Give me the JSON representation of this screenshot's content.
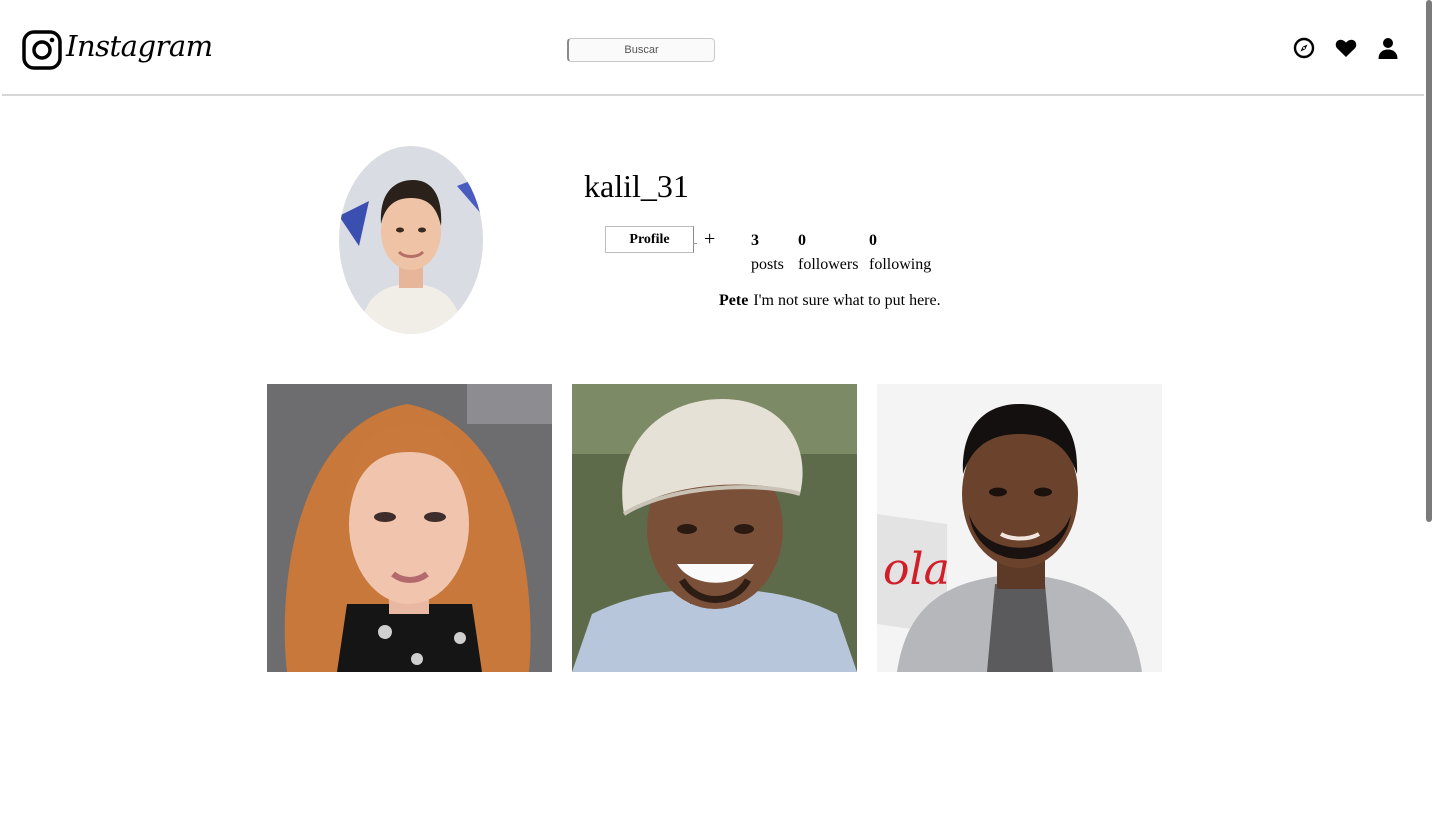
{
  "header": {
    "brand_name": "Instagram",
    "search_placeholder": "Buscar",
    "nav_icons": [
      "compass-icon",
      "heart-icon",
      "user-icon"
    ]
  },
  "profile": {
    "username": "kalil_31",
    "profile_button_label": "Profile",
    "add_button_label": "+",
    "stats": {
      "posts_count": "3",
      "posts_label": "posts",
      "followers_count": "0",
      "followers_label": "followers",
      "following_count": "0",
      "following_label": "following"
    },
    "bio_name": "Pete",
    "bio_text": "I'm not sure what to put here."
  },
  "posts": [
    {
      "subject": "woman-with-auburn-hair-photo"
    },
    {
      "subject": "smiling-man-in-flat-cap-photo"
    },
    {
      "subject": "man-in-grey-blazer-photo"
    }
  ],
  "colors": {
    "header_border": "#d6d6d6",
    "scrollbar_thumb": "#7b7b7b",
    "text": "#000000"
  }
}
